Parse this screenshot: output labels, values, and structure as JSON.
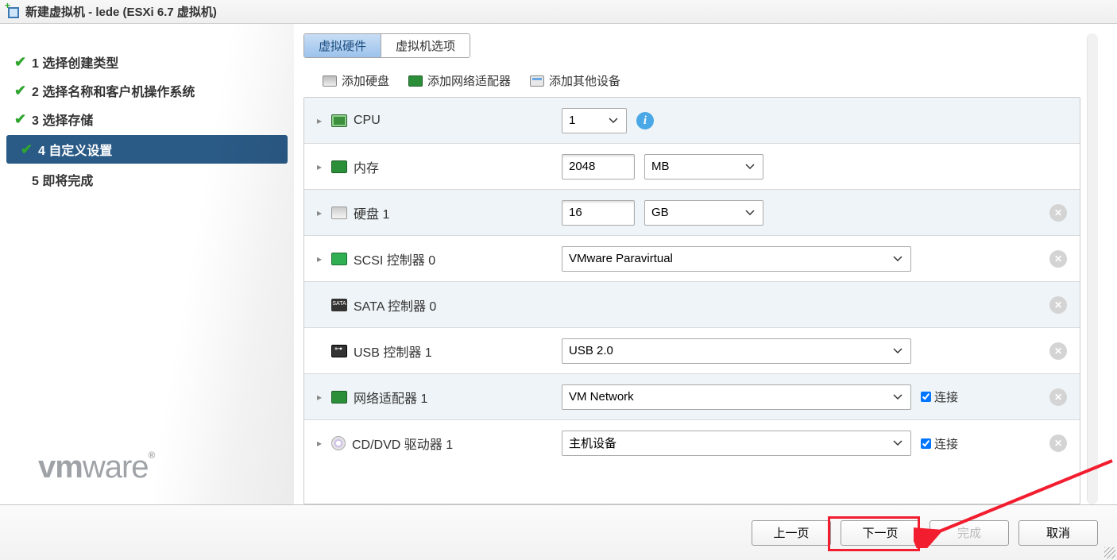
{
  "window": {
    "title": "新建虚拟机 - lede (ESXi 6.7 虚拟机)"
  },
  "wizard": {
    "steps": [
      {
        "num": "1",
        "label": "选择创建类型",
        "done": true
      },
      {
        "num": "2",
        "label": "选择名称和客户机操作系统",
        "done": true
      },
      {
        "num": "3",
        "label": "选择存储",
        "done": true
      },
      {
        "num": "4",
        "label": "自定义设置",
        "done": true,
        "active": true
      },
      {
        "num": "5",
        "label": "即将完成",
        "done": false
      }
    ]
  },
  "logo": {
    "text_a": "vm",
    "text_b": "ware"
  },
  "tabs": {
    "hardware": "虚拟硬件",
    "options": "虚拟机选项"
  },
  "addbar": {
    "hd": "添加硬盘",
    "nic": "添加网络适配器",
    "other": "添加其他设备"
  },
  "hw": {
    "cpu": {
      "label": "CPU",
      "value": "1"
    },
    "mem": {
      "label": "内存",
      "value": "2048",
      "unit": "MB"
    },
    "hd1": {
      "label": "硬盘 1",
      "value": "16",
      "unit": "GB"
    },
    "scsi0": {
      "label": "SCSI 控制器 0",
      "value": "VMware Paravirtual"
    },
    "sata0": {
      "label": "SATA 控制器 0"
    },
    "usb1": {
      "label": "USB 控制器 1",
      "value": "USB 2.0"
    },
    "nic1": {
      "label": "网络适配器 1",
      "value": "VM Network",
      "connect_label": "连接",
      "connected": true
    },
    "cd1": {
      "label": "CD/DVD 驱动器 1",
      "value": "主机设备",
      "connect_label": "连接",
      "connected": true
    }
  },
  "footer": {
    "back": "上一页",
    "next": "下一页",
    "finish": "完成",
    "cancel": "取消"
  }
}
